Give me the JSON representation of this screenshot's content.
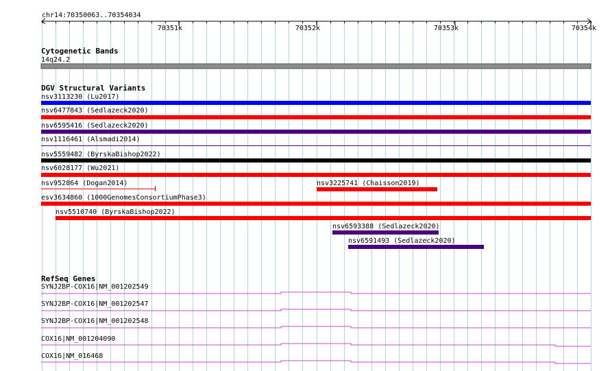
{
  "ruler": {
    "location": "chr14:70350063..70354034",
    "ticks": [
      "70351k",
      "70352k",
      "70353k",
      "70354k"
    ]
  },
  "tracks": {
    "cytoband": {
      "title": "Cytogenetic Bands",
      "band_label": "14q24.2",
      "band_color": "#8c8c8c"
    },
    "dgv": {
      "title": "DGV Structural Variants",
      "features": [
        {
          "label": "nsv3113230 (Lu2017)",
          "color": "#0000ff"
        },
        {
          "label": "nsv6477843 (Sedlazeck2020)",
          "color": "#ff0000"
        },
        {
          "label": "nsv6595416 (Sedlazeck2020)",
          "color": "#4b0082"
        },
        {
          "label": "nsv1116461 (Alsmadi2014)",
          "color": "#4b0082"
        },
        {
          "label": "nsv5559482 (ByrskaBishop2022)",
          "color": "#000000"
        },
        {
          "label": "nsv6028177 (Wu2021)",
          "color": "#ff0000"
        },
        {
          "label": "nsv952864 (Dogan2014)",
          "color": "#ff0000"
        },
        {
          "label": "nsv3225741 (Chaisson2019)",
          "color": "#ff0000"
        },
        {
          "label": "esv3634860 (1000GenomesConsortiumPhase3)",
          "color": "#ff0000"
        },
        {
          "label": "nsv5510740 (ByrskaBishop2022)",
          "color": "#ff0000"
        },
        {
          "label": "nsv6593388 (Sedlazeck2020)",
          "color": "#4b0082"
        },
        {
          "label": "nsv6591493 (Sedlazeck2020)",
          "color": "#4b0082"
        }
      ]
    },
    "refseq": {
      "title": "RefSeq Genes",
      "color": "#cc44cc",
      "genes": [
        {
          "label": "SYNJ2BP-COX16|NM_001202549"
        },
        {
          "label": "SYNJ2BP-COX16|NM_001202547"
        },
        {
          "label": "SYNJ2BP-COX16|NM_001202548"
        },
        {
          "label": "COX16|NM_001204090"
        },
        {
          "label": "COX16|NM_016468"
        }
      ]
    }
  },
  "colors": {
    "grid": "#a8d8ea",
    "ruler": "#000000"
  }
}
